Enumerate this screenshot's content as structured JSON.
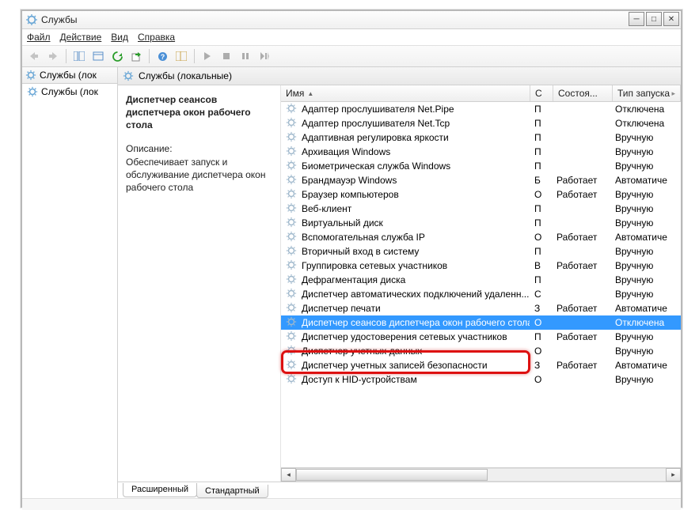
{
  "window": {
    "title": "Службы"
  },
  "menu": {
    "file": "Файл",
    "action": "Действие",
    "view": "Вид",
    "help": "Справка"
  },
  "tree": {
    "header": "Службы (лок",
    "item": "Службы (лок"
  },
  "main": {
    "header": "Службы (локальные)"
  },
  "desc": {
    "selected": "Диспетчер сеансов диспетчера окон рабочего стола",
    "label": "Описание:",
    "text": "Обеспечивает запуск и обслуживание диспетчера окон рабочего стола"
  },
  "columns": {
    "name": "Имя",
    "desc": "С",
    "state": "Состоя...",
    "startup": "Тип запуска"
  },
  "tabs": {
    "ext": "Расширенный",
    "std": "Стандартный"
  },
  "statusRunning": "Работает",
  "services": [
    {
      "name": "Адаптер прослушивателя Net.Pipe",
      "d": "П",
      "state": "",
      "startup": "Отключена"
    },
    {
      "name": "Адаптер прослушивателя Net.Tcp",
      "d": "П",
      "state": "",
      "startup": "Отключена"
    },
    {
      "name": "Адаптивная регулировка яркости",
      "d": "П",
      "state": "",
      "startup": "Вручную"
    },
    {
      "name": "Архивация Windows",
      "d": "П",
      "state": "",
      "startup": "Вручную"
    },
    {
      "name": "Биометрическая служба Windows",
      "d": "П",
      "state": "",
      "startup": "Вручную"
    },
    {
      "name": "Брандмауэр Windows",
      "d": "Б",
      "state": "Работает",
      "startup": "Автоматиче"
    },
    {
      "name": "Браузер компьютеров",
      "d": "О",
      "state": "Работает",
      "startup": "Вручную"
    },
    {
      "name": "Веб-клиент",
      "d": "П",
      "state": "",
      "startup": "Вручную"
    },
    {
      "name": "Виртуальный диск",
      "d": "П",
      "state": "",
      "startup": "Вручную"
    },
    {
      "name": "Вспомогательная служба IP",
      "d": "О",
      "state": "Работает",
      "startup": "Автоматиче"
    },
    {
      "name": "Вторичный вход в систему",
      "d": "П",
      "state": "",
      "startup": "Вручную"
    },
    {
      "name": "Группировка сетевых участников",
      "d": "В",
      "state": "Работает",
      "startup": "Вручную"
    },
    {
      "name": "Дефрагментация диска",
      "d": "П",
      "state": "",
      "startup": "Вручную"
    },
    {
      "name": "Диспетчер автоматических подключений удаленн...",
      "d": "С",
      "state": "",
      "startup": "Вручную"
    },
    {
      "name": "Диспетчер печати",
      "d": "З",
      "state": "Работает",
      "startup": "Автоматиче"
    },
    {
      "name": "Диспетчер сеансов диспетчера окон рабочего стола",
      "d": "О",
      "state": "",
      "startup": "Отключена",
      "sel": true
    },
    {
      "name": "Диспетчер удостоверения сетевых участников",
      "d": "П",
      "state": "Работает",
      "startup": "Вручную"
    },
    {
      "name": "Диспетчер учетных данных",
      "d": "О",
      "state": "",
      "startup": "Вручную"
    },
    {
      "name": "Диспетчер учетных записей безопасности",
      "d": "З",
      "state": "Работает",
      "startup": "Автоматиче"
    },
    {
      "name": "Доступ к HID-устройствам",
      "d": "О",
      "state": "",
      "startup": "Вручную"
    }
  ]
}
